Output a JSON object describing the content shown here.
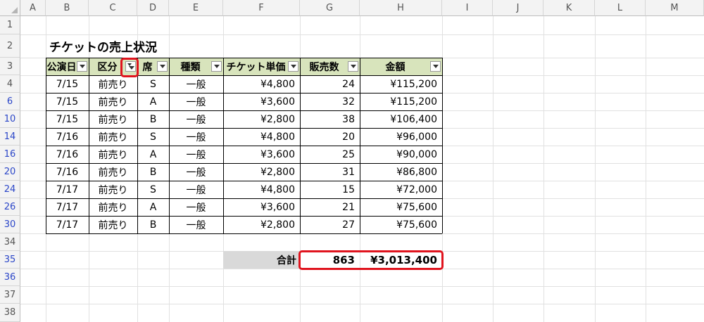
{
  "columns": [
    "A",
    "B",
    "C",
    "D",
    "E",
    "F",
    "G",
    "H",
    "I",
    "J",
    "K",
    "L",
    "M"
  ],
  "rows": [
    "1",
    "2",
    "3",
    "4",
    "6",
    "10",
    "14",
    "16",
    "20",
    "24",
    "26",
    "30",
    "34",
    "35",
    "36",
    "37",
    "38"
  ],
  "title": "チケットの売上状況",
  "headers": [
    "公演日",
    "区分",
    "席",
    "種類",
    "チケット単価",
    "販売数",
    "金額"
  ],
  "table_rows": [
    [
      "7/15",
      "前売り",
      "S",
      "一般",
      "¥4,800",
      "24",
      "¥115,200"
    ],
    [
      "7/15",
      "前売り",
      "A",
      "一般",
      "¥3,600",
      "32",
      "¥115,200"
    ],
    [
      "7/15",
      "前売り",
      "B",
      "一般",
      "¥2,800",
      "38",
      "¥106,400"
    ],
    [
      "7/16",
      "前売り",
      "S",
      "一般",
      "¥4,800",
      "20",
      "¥96,000"
    ],
    [
      "7/16",
      "前売り",
      "A",
      "一般",
      "¥3,600",
      "25",
      "¥90,000"
    ],
    [
      "7/16",
      "前売り",
      "B",
      "一般",
      "¥2,800",
      "31",
      "¥86,800"
    ],
    [
      "7/17",
      "前売り",
      "S",
      "一般",
      "¥4,800",
      "15",
      "¥72,000"
    ],
    [
      "7/17",
      "前売り",
      "A",
      "一般",
      "¥3,600",
      "21",
      "¥75,600"
    ],
    [
      "7/17",
      "前売り",
      "B",
      "一般",
      "¥2,800",
      "27",
      "¥75,600"
    ]
  ],
  "total": {
    "label": "合計",
    "count": "863",
    "amount": "¥3,013,400"
  },
  "colors": {
    "header_fill": "#d8e4bc",
    "highlight": "#e0141e",
    "filtered_row_number": "#2b46c8",
    "total_label_fill": "#d9d9d9"
  },
  "icons": {
    "filter_button": "dropdown-arrow-icon",
    "active_filter": "funnel-filter-icon"
  }
}
